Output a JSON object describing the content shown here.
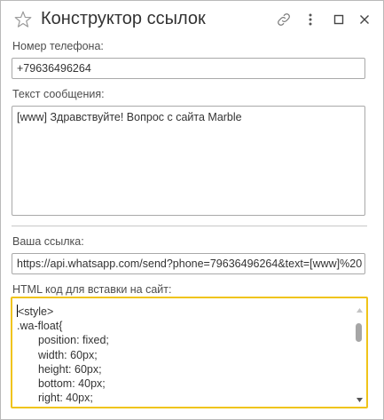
{
  "window": {
    "title": "Конструктор ссылок"
  },
  "icons": {
    "star": "star-icon",
    "link": "link-icon",
    "more": "more-vertical-icon",
    "maximize": "maximize-icon",
    "close": "close-icon"
  },
  "colors": {
    "focus_border": "#f0c419",
    "field_border": "#a9a9a9",
    "text": "#333333"
  },
  "phone": {
    "label": "Номер телефона:",
    "value": "+79636496264"
  },
  "message": {
    "label": "Текст сообщения:",
    "value": "[www] Здравствуйте! Вопрос с сайта Marble"
  },
  "link": {
    "label": "Ваша ссылка:",
    "value": "https://api.whatsapp.com/send?phone=79636496264&text=[www]%20"
  },
  "html_code": {
    "label": "HTML код для вставки на сайт:",
    "lines": [
      "<style>",
      ".wa-float{",
      "position: fixed;",
      "width: 60px;",
      "height: 60px;",
      "bottom: 40px;",
      "right: 40px;"
    ]
  }
}
